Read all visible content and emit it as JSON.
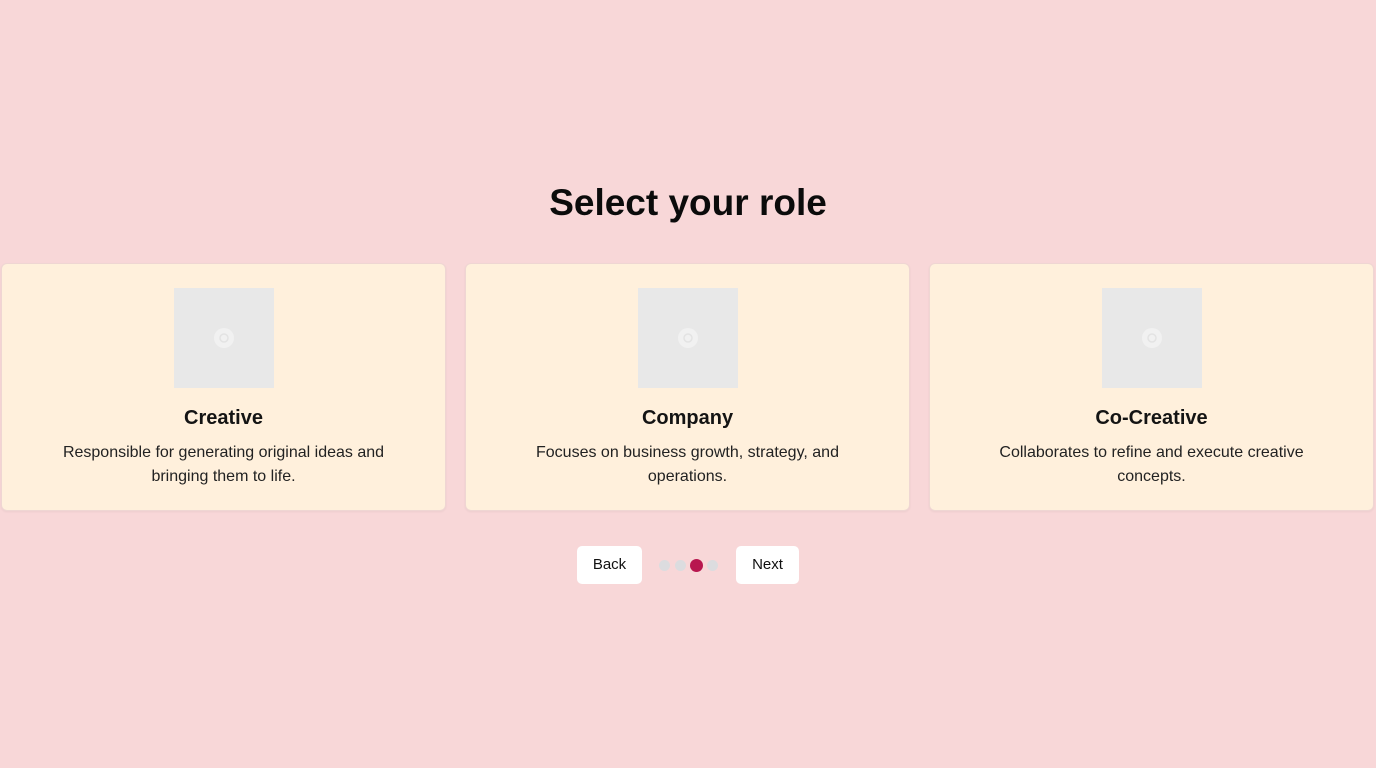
{
  "page": {
    "title": "Select your role"
  },
  "roles": [
    {
      "name": "Creative",
      "description": "Responsible for generating original ideas and bringing them to life.",
      "image_icon": "image-placeholder-icon"
    },
    {
      "name": "Company",
      "description": "Focuses on business growth, strategy, and operations.",
      "image_icon": "image-placeholder-icon"
    },
    {
      "name": "Co-Creative",
      "description": "Collaborates to refine and execute creative concepts.",
      "image_icon": "image-placeholder-icon"
    }
  ],
  "navigation": {
    "back_label": "Back",
    "next_label": "Next",
    "steps_total": 4,
    "current_step": 3
  },
  "colors": {
    "background": "#f8d7d8",
    "card_background": "#fff0dc",
    "active_dot": "#b8174f",
    "inactive_dot": "#dcdcdf"
  }
}
